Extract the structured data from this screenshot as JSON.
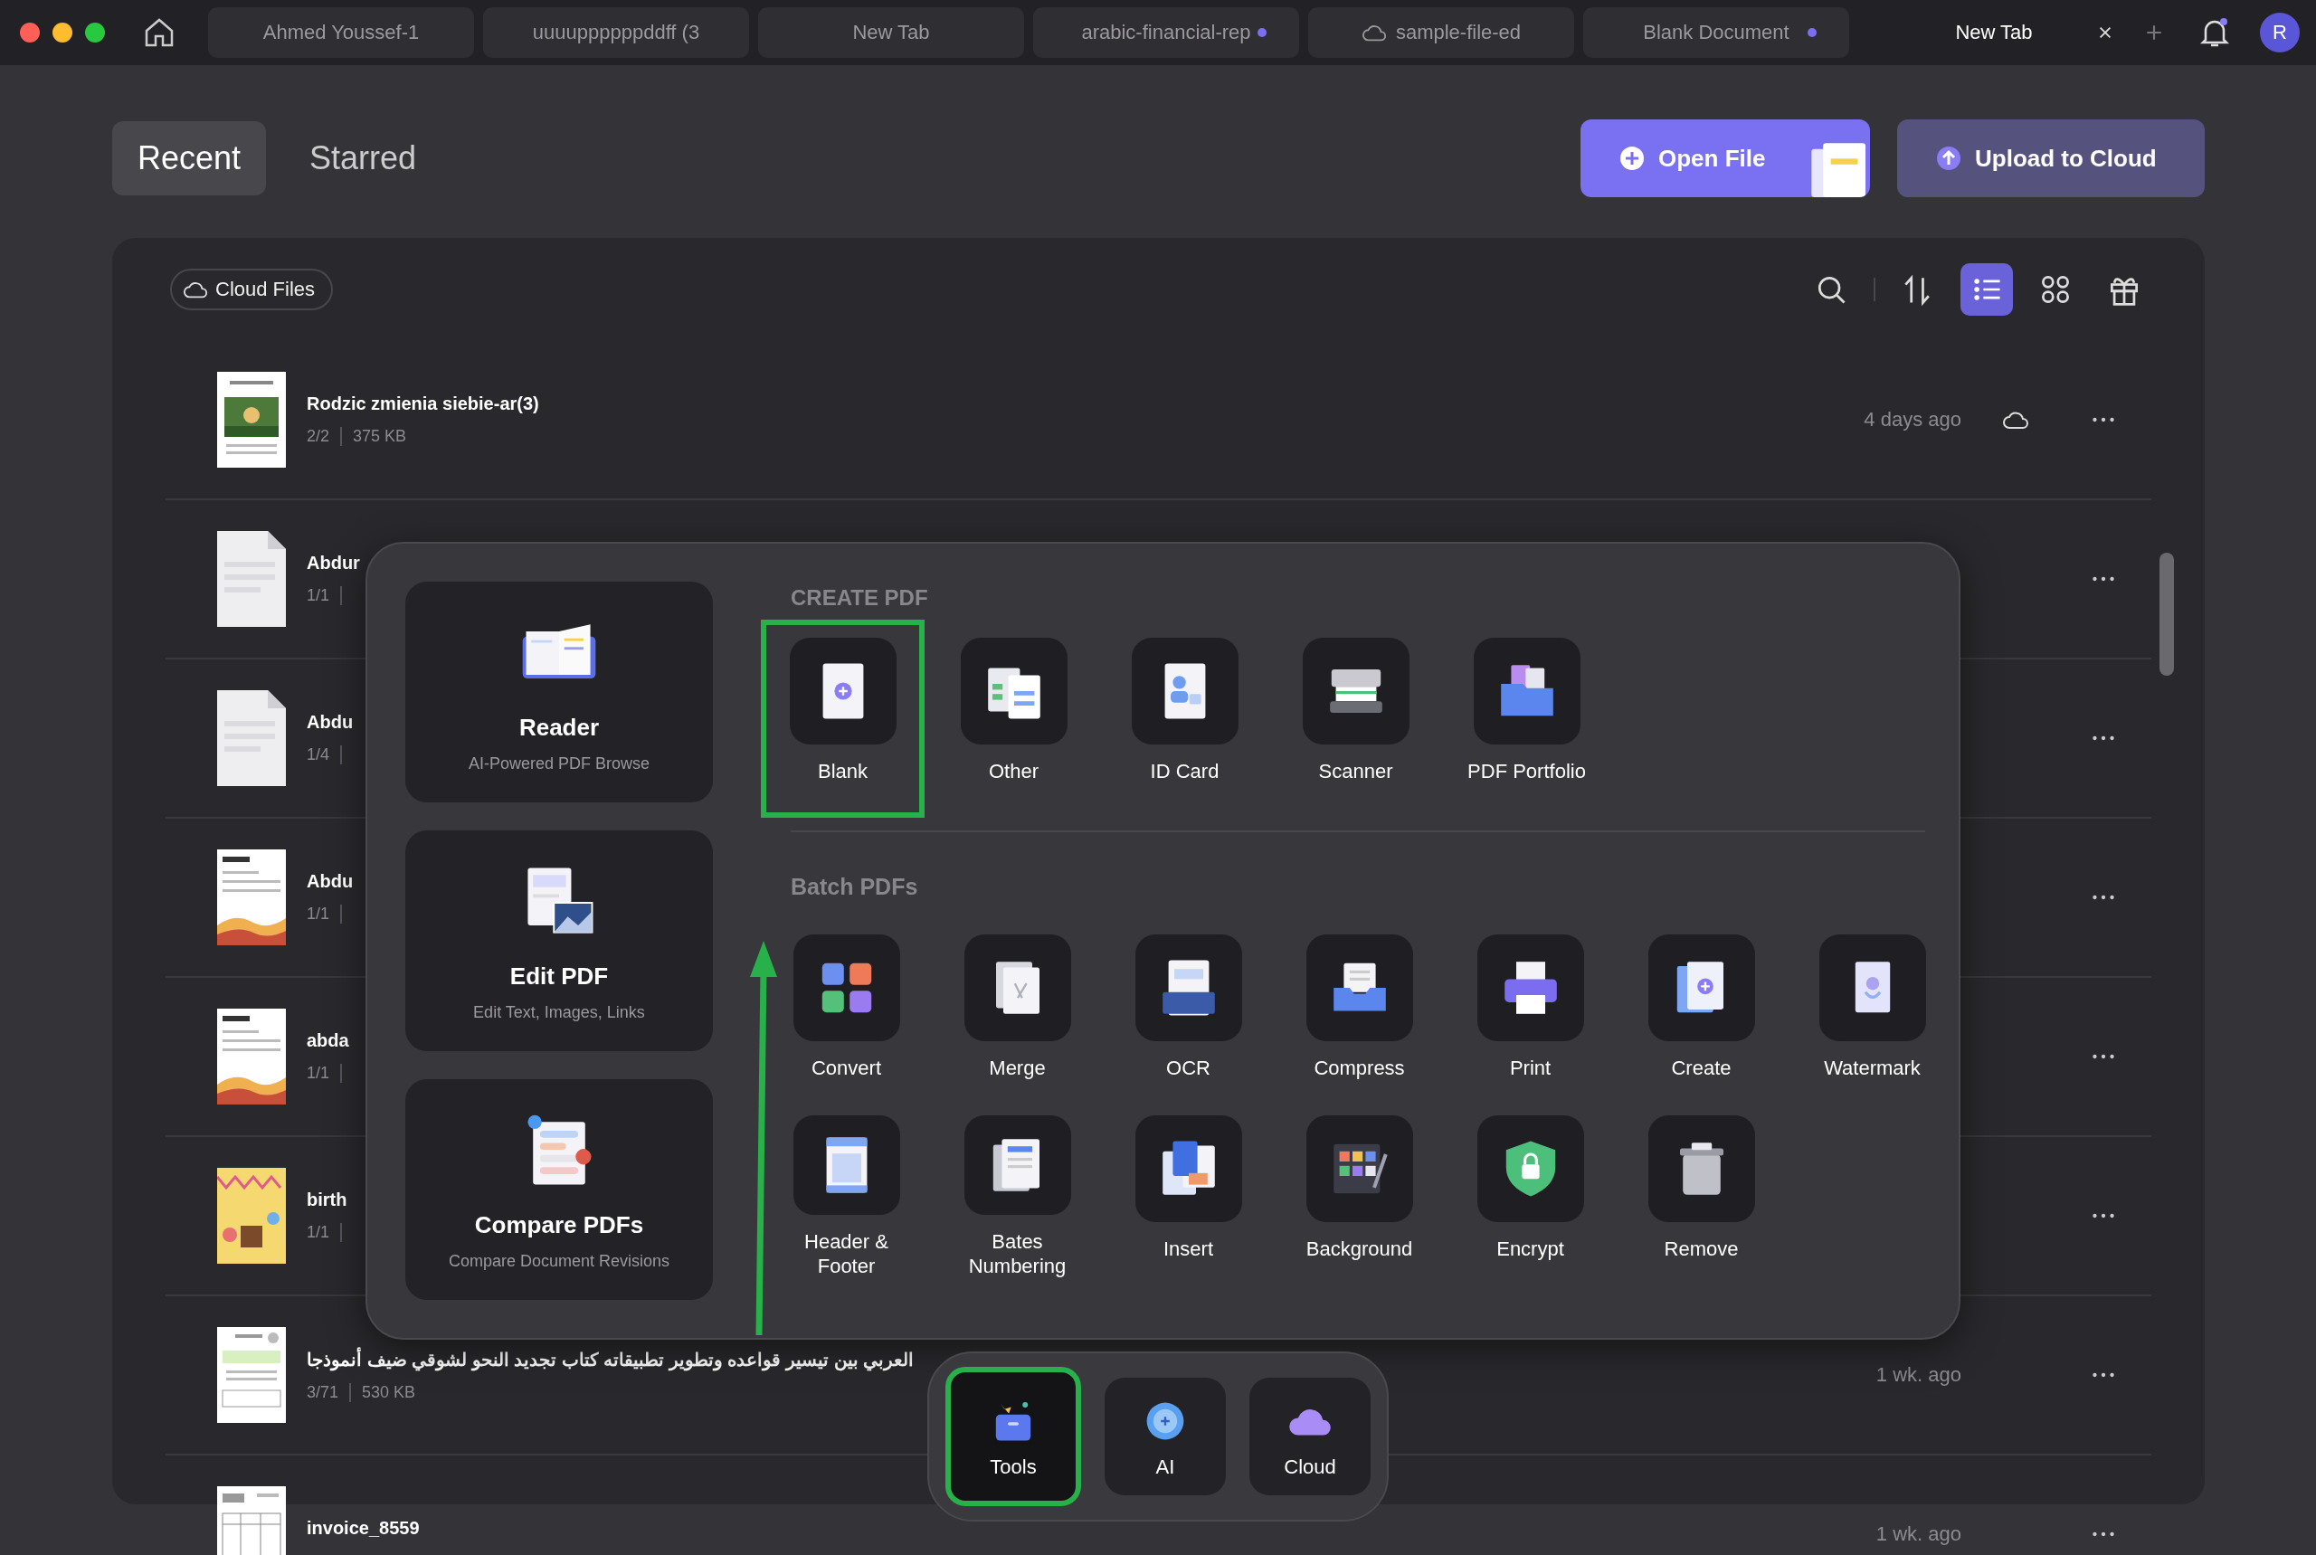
{
  "tabs": [
    {
      "label": "Ahmed Youssef-1",
      "selected": false,
      "dot": false,
      "cloud": false
    },
    {
      "label": "uuuuppppppddff (3",
      "selected": false,
      "dot": false,
      "cloud": false
    },
    {
      "label": "New Tab",
      "selected": false,
      "dot": false,
      "cloud": false
    },
    {
      "label": "arabic-financial-rep",
      "selected": false,
      "dot": true,
      "cloud": false
    },
    {
      "label": "sample-file-ed",
      "selected": false,
      "dot": false,
      "cloud": true
    },
    {
      "label": "Blank Document",
      "selected": false,
      "dot": true,
      "cloud": false
    },
    {
      "label": "New Tab",
      "selected": true,
      "dot": false,
      "cloud": false
    }
  ],
  "avatar": "R",
  "header": {
    "tabs": [
      {
        "label": "Recent",
        "selected": true
      },
      {
        "label": "Starred",
        "selected": false
      }
    ],
    "buttons": [
      {
        "label": "Open File",
        "kind": "primary"
      },
      {
        "label": "Upload to Cloud",
        "kind": "secondary"
      }
    ]
  },
  "cloud_files": "Cloud Files",
  "toolbar": [
    {
      "kind": "search",
      "selected": false
    },
    {
      "kind": "sort",
      "selected": false
    },
    {
      "kind": "list",
      "selected": true
    },
    {
      "kind": "grid",
      "selected": false
    },
    {
      "kind": "gift",
      "selected": false
    }
  ],
  "files": [
    {
      "name": "Rodzic zmienia siebie-ar(3)",
      "pages": "2/2",
      "size": "375 KB",
      "date": "4 days ago",
      "cloud": true,
      "kind": "photo"
    },
    {
      "name": "Abdur",
      "pages": "1/1",
      "kind": "blank"
    },
    {
      "name": "Abdu",
      "pages": "1/4",
      "kind": "blank"
    },
    {
      "name": "Abdu",
      "pages": "1/1",
      "kind": "invoice"
    },
    {
      "name": "abda",
      "pages": "1/1",
      "kind": "invoice"
    },
    {
      "name": "birth",
      "pages": "1/1",
      "kind": "birthday"
    },
    {
      "name": "العربي بين تيسير قواعده وتطوير تطبيقاته كتاب تجديد النحو لشوقي ضيف أنموذجا",
      "pages": "3/71",
      "size": "530 KB",
      "date": "1 wk. ago",
      "cloud": false,
      "kind": "arabic"
    },
    {
      "name": "invoice_8559",
      "date": "1 wk. ago",
      "cloud": false,
      "kind": "table"
    }
  ],
  "tools": {
    "cards": [
      {
        "title": "Reader",
        "subtitle": "AI-Powered PDF Browse",
        "kind": "reader"
      },
      {
        "title": "Edit PDF",
        "subtitle": "Edit Text, Images, Links",
        "kind": "edit"
      },
      {
        "title": "Compare PDFs",
        "subtitle": "Compare Document Revisions",
        "kind": "compare"
      }
    ],
    "create": {
      "heading": "CREATE PDF",
      "items": [
        {
          "label": "Blank",
          "kind": "blank",
          "selected": true
        },
        {
          "label": "Other",
          "kind": "other",
          "selected": false
        },
        {
          "label": "ID Card",
          "kind": "idcard",
          "selected": false
        },
        {
          "label": "Scanner",
          "kind": "scanner",
          "selected": false
        },
        {
          "label": "PDF Portfolio",
          "kind": "portfolio",
          "selected": false
        }
      ]
    },
    "batch": {
      "heading": "Batch PDFs",
      "items": [
        {
          "label": "Convert",
          "kind": "convert"
        },
        {
          "label": "Merge",
          "kind": "merge"
        },
        {
          "label": "OCR",
          "kind": "ocr"
        },
        {
          "label": "Compress",
          "kind": "compress"
        },
        {
          "label": "Print",
          "kind": "print"
        },
        {
          "label": "Create",
          "kind": "create"
        },
        {
          "label": "Watermark",
          "kind": "watermark"
        },
        {
          "label": "Header & Footer",
          "kind": "header"
        },
        {
          "label": "Bates Numbering",
          "kind": "bates"
        },
        {
          "label": "Insert",
          "kind": "insert"
        },
        {
          "label": "Background",
          "kind": "background"
        },
        {
          "label": "Encrypt",
          "kind": "encrypt"
        },
        {
          "label": "Remove",
          "kind": "remove"
        }
      ]
    }
  },
  "dock": [
    {
      "label": "Tools",
      "kind": "tools",
      "selected": true
    },
    {
      "label": "AI",
      "kind": "ai",
      "selected": false
    },
    {
      "label": "Cloud",
      "kind": "cloud",
      "selected": false
    }
  ]
}
